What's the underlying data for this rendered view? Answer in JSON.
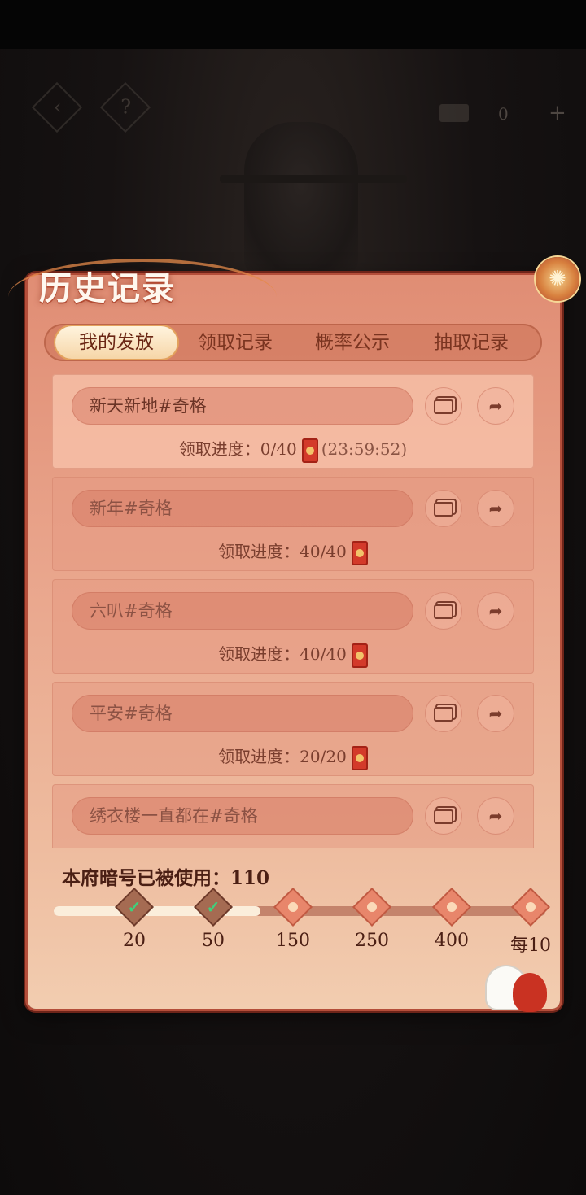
{
  "panel": {
    "title": "历史记录"
  },
  "tabs": [
    {
      "label": "我的发放",
      "active": true
    },
    {
      "label": "领取记录",
      "active": false
    },
    {
      "label": "概率公示",
      "active": false
    },
    {
      "label": "抽取记录",
      "active": false
    }
  ],
  "records": [
    {
      "name": "新天新地#奇格",
      "progress": "领取进度：0/40",
      "countdown": "(23:59:52)"
    },
    {
      "name": "新年#奇格",
      "progress": "领取进度：40/40"
    },
    {
      "name": "六叭#奇格",
      "progress": "领取进度：40/40"
    },
    {
      "name": "平安#奇格",
      "progress": "领取进度：20/20"
    },
    {
      "name": "绣衣楼一直都在#奇格",
      "progress": ""
    }
  ],
  "usage": {
    "label": "本府暗号已被使用：110"
  },
  "milestones": [
    {
      "label": "20",
      "reached": true
    },
    {
      "label": "50",
      "reached": true
    },
    {
      "label": "150",
      "reached": false
    },
    {
      "label": "250",
      "reached": false
    },
    {
      "label": "400",
      "reached": false
    },
    {
      "label": "每10",
      "reached": false
    }
  ],
  "milestone_progress_fraction": 0.42,
  "top_bar": {
    "back_icon": "back-arrow-icon",
    "help_icon": "question-mark-icon",
    "help_symbol": "?",
    "resource_count": "0",
    "plus_symbol": "+"
  },
  "colors": {
    "panel": "#e9a58c",
    "accent": "#b44e3a",
    "check": "#3ed17c"
  }
}
